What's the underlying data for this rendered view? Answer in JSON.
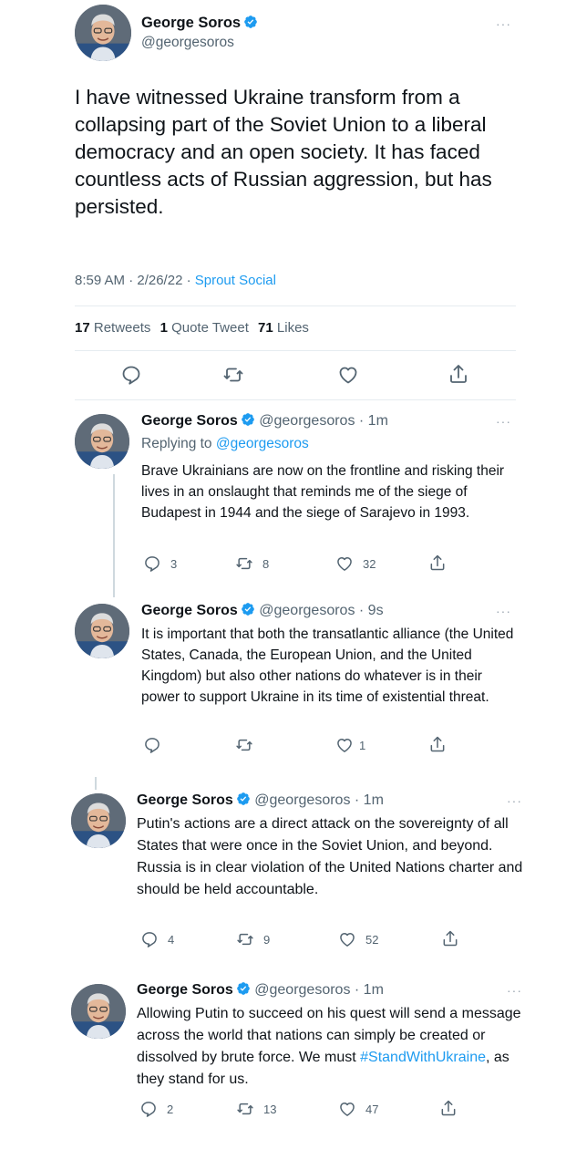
{
  "main_tweet": {
    "author_name": "George Soros",
    "author_handle": "@georgesoros",
    "text": "I have witnessed Ukraine transform from a collapsing part of the Soviet Union to a liberal democracy and an open society. It has faced countless acts of Russian aggression, but has persisted.",
    "time": "8:59 AM · 2/26/22 · ",
    "source": "Sprout Social",
    "stats": {
      "retweets_count": "17",
      "retweets_label": "Retweets",
      "quotes_count": "1",
      "quotes_label": "Quote Tweet",
      "likes_count": "71",
      "likes_label": "Likes"
    }
  },
  "replies": [
    {
      "author_name": "George Soros",
      "handle_time": "@georgesoros · 1m",
      "replying_prefix": "Replying to ",
      "replying_to": "@georgesoros",
      "text": "Brave Ukrainians are now on the frontline and risking their lives in an onslaught that reminds me of the siege of Budapest in 1944 and the siege of Sarajevo in 1993.",
      "replies": "3",
      "retweets": "8",
      "likes": "32"
    },
    {
      "author_name": "George Soros",
      "handle_time": "@georgesoros · 9s",
      "text": "It is important that both the transatlantic alliance (the United States, Canada, the European Union, and the United Kingdom) but also other nations do whatever is in their power to support Ukraine in its time of existential threat.",
      "replies": "",
      "retweets": "",
      "likes": "1"
    },
    {
      "author_name": "George Soros",
      "handle_time": "@georgesoros · 1m",
      "text": "Putin's actions are a direct attack on the sovereignty of all States that were once in the Soviet Union, and beyond. Russia is in clear violation of the United Nations charter and should be held accountable.",
      "replies": "4",
      "retweets": "9",
      "likes": "52"
    },
    {
      "author_name": "George Soros",
      "handle_time": "@georgesoros · 1m",
      "text_before": "Allowing Putin to succeed on his quest will send a message across the world that nations can simply be created or dissolved by brute force. We must ",
      "hashtag": "#StandWithUkraine",
      "text_after": ", as they stand for us.",
      "replies": "2",
      "retweets": "13",
      "likes": "47"
    }
  ],
  "more_label": "···",
  "icons": {
    "verified": "verified-badge-icon",
    "reply": "reply-icon",
    "retweet": "retweet-icon",
    "like": "heart-icon",
    "share": "share-icon"
  },
  "colors": {
    "accent": "#1d9bf0",
    "secondary_text": "#536471",
    "divider": "#e6ecf0"
  }
}
